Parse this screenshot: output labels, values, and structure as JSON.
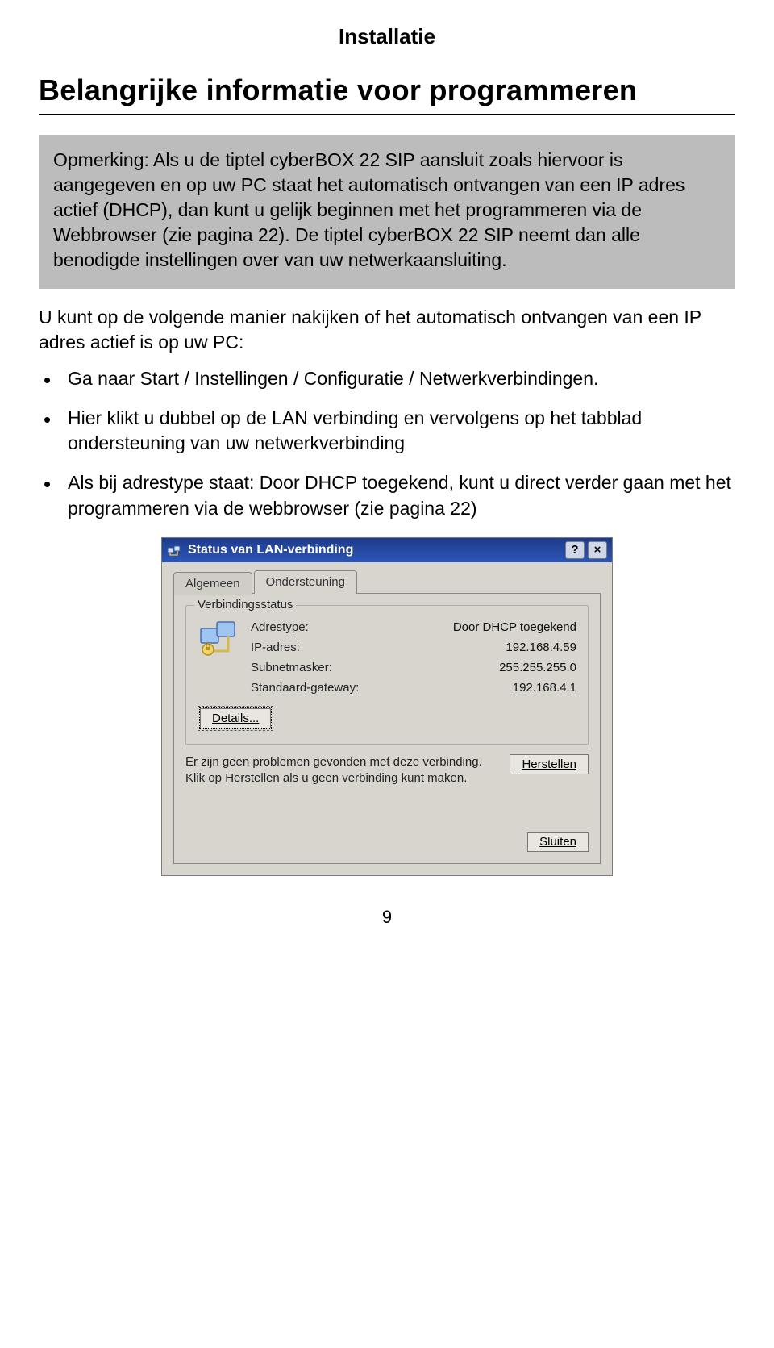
{
  "section_header": "Installatie",
  "heading": "Belangrijke informatie voor programmeren",
  "note": "Opmerking: Als u de tiptel cyberBOX 22 SIP aansluit zoals hiervoor is aangegeven en op uw PC staat het automatisch ontvangen van een IP adres actief (DHCP), dan kunt u gelijk beginnen met het programmeren via de Webbrowser (zie pagina 22). De tiptel cyberBOX 22 SIP neemt dan alle benodigde instellingen over van uw netwerkaansluiting.",
  "intro_text": "U kunt op de volgende manier nakijken of het automatisch ontvangen van een IP adres actief is op uw PC:",
  "bullets": [
    "Ga naar Start / Instellingen / Configuratie / Netwerkverbindingen.",
    "Hier klikt u dubbel op de LAN verbinding en vervolgens op het tabblad ondersteuning van uw netwerkverbinding",
    "Als bij adrestype staat: Door DHCP toegekend, kunt u direct verder gaan met het programmeren via de webbrowser (zie pagina 22)"
  ],
  "dialog": {
    "title": "Status van LAN-verbinding",
    "help_btn": "?",
    "close_btn": "×",
    "tabs": {
      "general": "Algemeen",
      "support": "Ondersteuning"
    },
    "group_legend": "Verbindingsstatus",
    "rows": {
      "addr_type_label": "Adrestype:",
      "addr_type_value": "Door DHCP toegekend",
      "ip_label": "IP-adres:",
      "ip_value": "192.168.4.59",
      "subnet_label": "Subnetmasker:",
      "subnet_value": "255.255.255.0",
      "gateway_label": "Standaard-gateway:",
      "gateway_value": "192.168.4.1"
    },
    "details_btn": "Details...",
    "repair_text": "Er zijn geen problemen gevonden met deze verbinding. Klik op Herstellen als u geen verbinding kunt maken.",
    "repair_btn": "Herstellen",
    "close_footer_btn": "Sluiten"
  },
  "page_number": "9"
}
